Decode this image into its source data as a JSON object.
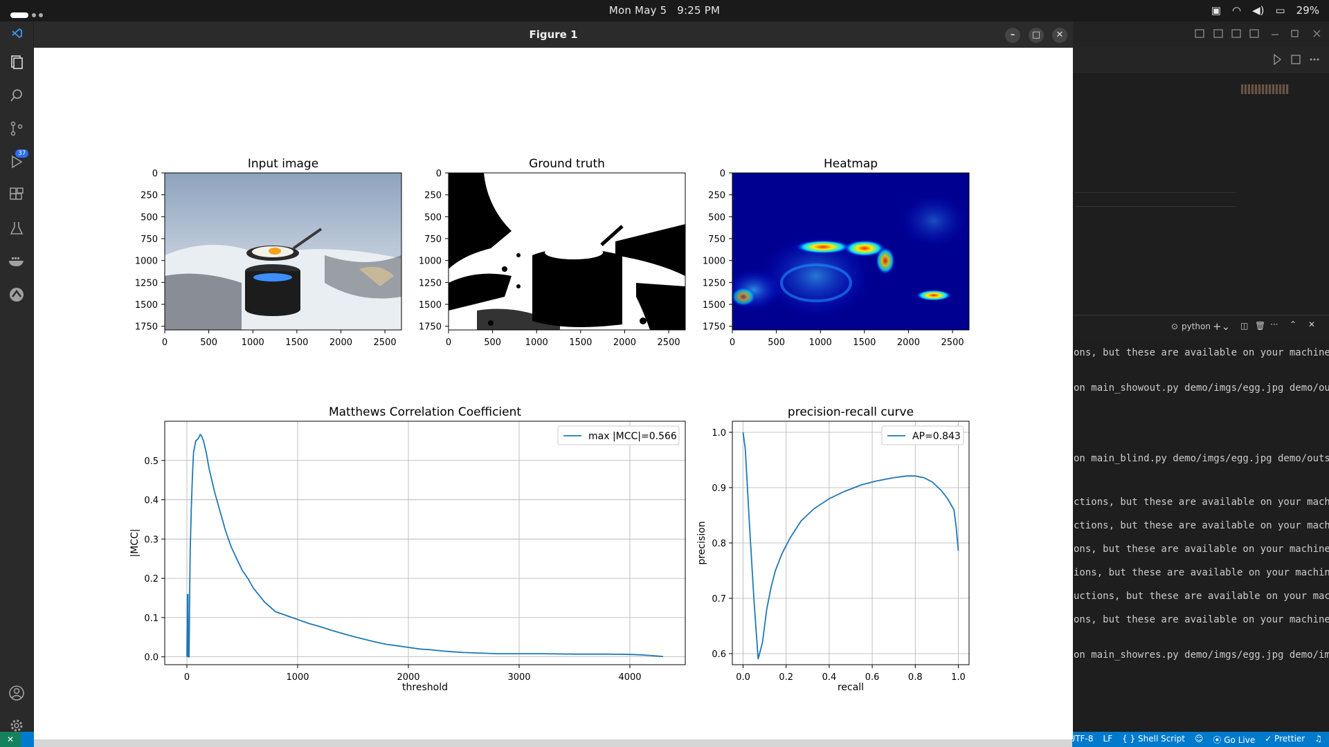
{
  "topbar": {
    "date": "Mon May 5",
    "time": "9:25 PM",
    "battery": "29%"
  },
  "figure_window": {
    "title": "Figure 1"
  },
  "vscode": {
    "scm_badge": "37",
    "terminal_label": "python",
    "terminal_lines": [
      "ons, but these are available on your machine",
      "on main_showout.py demo/imgs/egg.jpg demo/ou",
      "on main_blind.py demo/imgs/egg.jpg demo/outs",
      "ctions, but these are available on your mach",
      "ctions, but these are available on your mach",
      "ons, but these are available on your machine",
      "ions, but these are available on your machin",
      "uctions, but these are available on your mac",
      "ons, but these are available on your machine",
      "on main_showres.py demo/imgs/egg.jpg demo/im"
    ],
    "status": {
      "encoding": "UTF-8",
      "eol": "LF",
      "language": "{ } Shell Script",
      "golive": "Go Live",
      "prettier": "Prettier"
    }
  },
  "panels": {
    "input": {
      "title": "Input image"
    },
    "gt": {
      "title": "Ground truth"
    },
    "heat": {
      "title": "Heatmap"
    },
    "image_xticks": [
      "0",
      "500",
      "1000",
      "1500",
      "2000",
      "2500"
    ],
    "image_yticks": [
      "0",
      "250",
      "500",
      "750",
      "1000",
      "1250",
      "1500",
      "1750"
    ]
  },
  "chart_data": [
    {
      "type": "line",
      "title": "Matthews Correlation Coefficient",
      "xlabel": "threshold",
      "ylabel": "|MCC|",
      "xlim": [
        -200,
        4500
      ],
      "ylim": [
        -0.02,
        0.6
      ],
      "xticks": [
        0,
        1000,
        2000,
        3000,
        4000
      ],
      "yticks": [
        0.0,
        0.1,
        0.2,
        0.3,
        0.4,
        0.5
      ],
      "grid": true,
      "legend_position": "upper right",
      "color": "#1f77b4",
      "series": [
        {
          "name": "max |MCC|=0.566",
          "x": [
            0,
            5,
            8,
            10,
            12,
            14,
            15,
            20,
            25,
            30,
            40,
            50,
            60,
            80,
            100,
            110,
            120,
            130,
            150,
            175,
            200,
            250,
            300,
            350,
            400,
            450,
            500,
            550,
            600,
            700,
            800,
            900,
            1000,
            1100,
            1200,
            1300,
            1400,
            1500,
            1600,
            1700,
            1800,
            1900,
            2000,
            2100,
            2200,
            2300,
            2400,
            2500,
            2600,
            2700,
            2800,
            3000,
            3200,
            3500,
            3800,
            4000,
            4100,
            4200,
            4300
          ],
          "y": [
            0.0,
            0.16,
            0.15,
            0.16,
            0.0,
            0.0,
            0.0,
            0.0,
            0.16,
            0.27,
            0.38,
            0.46,
            0.52,
            0.55,
            0.555,
            0.56,
            0.566,
            0.564,
            0.55,
            0.52,
            0.48,
            0.42,
            0.37,
            0.32,
            0.28,
            0.25,
            0.22,
            0.2,
            0.175,
            0.14,
            0.115,
            0.105,
            0.095,
            0.085,
            0.077,
            0.068,
            0.06,
            0.052,
            0.045,
            0.038,
            0.032,
            0.028,
            0.024,
            0.02,
            0.018,
            0.015,
            0.013,
            0.011,
            0.01,
            0.009,
            0.008,
            0.008,
            0.008,
            0.007,
            0.007,
            0.006,
            0.005,
            0.003,
            0.001
          ]
        }
      ]
    },
    {
      "type": "line",
      "title": "precision-recall curve",
      "xlabel": "recall",
      "ylabel": "precision",
      "xlim": [
        -0.05,
        1.05
      ],
      "ylim": [
        0.58,
        1.02
      ],
      "xticks": [
        0.0,
        0.2,
        0.4,
        0.6,
        0.8,
        1.0
      ],
      "yticks": [
        0.6,
        0.7,
        0.8,
        0.9,
        1.0
      ],
      "grid": true,
      "legend_position": "upper right",
      "color": "#1f77b4",
      "series": [
        {
          "name": "AP=0.843",
          "x": [
            0.0,
            0.01,
            0.03,
            0.05,
            0.07,
            0.09,
            0.11,
            0.13,
            0.15,
            0.18,
            0.22,
            0.27,
            0.33,
            0.4,
            0.47,
            0.55,
            0.62,
            0.7,
            0.76,
            0.8,
            0.84,
            0.88,
            0.92,
            0.95,
            0.98,
            0.99,
            1.0
          ],
          "y": [
            1.0,
            0.97,
            0.83,
            0.7,
            0.59,
            0.62,
            0.68,
            0.72,
            0.75,
            0.78,
            0.81,
            0.84,
            0.862,
            0.88,
            0.893,
            0.905,
            0.912,
            0.918,
            0.921,
            0.921,
            0.918,
            0.91,
            0.895,
            0.88,
            0.86,
            0.83,
            0.786
          ]
        }
      ]
    }
  ]
}
